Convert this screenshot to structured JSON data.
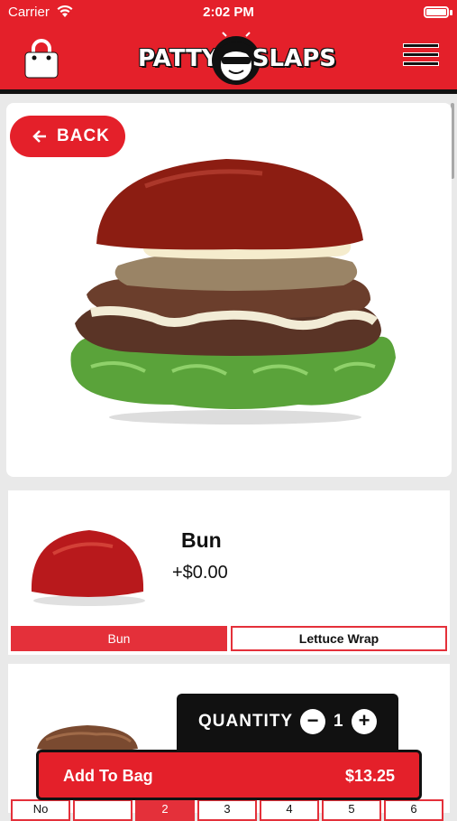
{
  "status_bar": {
    "carrier": "Carrier",
    "time": "2:02 PM"
  },
  "header": {
    "logo_left": "PATTY",
    "logo_right": "SLAPS",
    "bag_icon": "shopping-bag-icon",
    "menu_icon": "hamburger-menu-icon"
  },
  "hero": {
    "back_label": "BACK",
    "image": "burger-photo"
  },
  "bun_option": {
    "title": "Bun",
    "price": "+$0.00",
    "choices": [
      {
        "label": "Bun",
        "selected": true
      },
      {
        "label": "Lettuce Wrap",
        "selected": false
      }
    ]
  },
  "patty_option": {
    "choices": [
      "No",
      "",
      "2",
      "3",
      "4",
      "5",
      "6"
    ],
    "selected_index": 2
  },
  "quantity": {
    "label": "QUANTITY",
    "value": "1"
  },
  "add_to_bag": {
    "label": "Add To Bag",
    "price": "$13.25"
  },
  "colors": {
    "brand_red": "#e4202a",
    "dark": "#111111"
  }
}
